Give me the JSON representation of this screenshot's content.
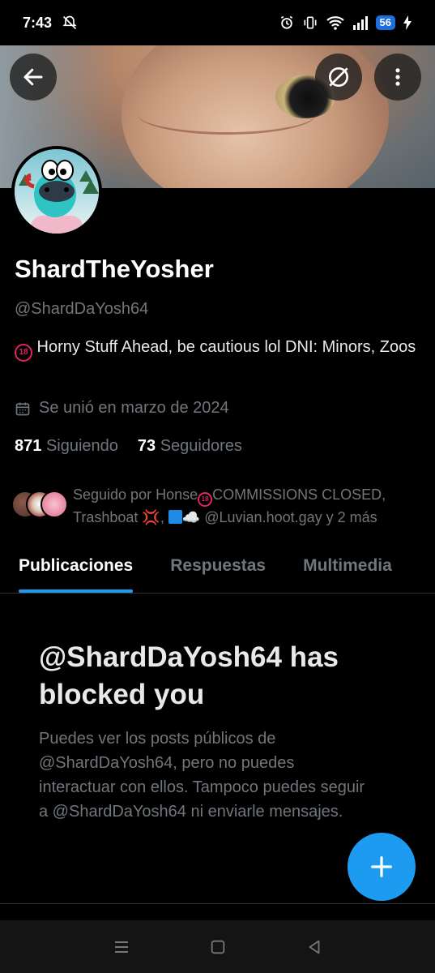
{
  "status_bar": {
    "time": "7:43",
    "battery_level": "56"
  },
  "header": {
    "back_icon": "arrow-left-icon",
    "translate_icon": "grok-circle-icon",
    "more_icon": "more-vertical-icon"
  },
  "profile": {
    "display_name": "ShardTheYosher",
    "handle": "@ShardDaYosh64",
    "bio_badge": "18",
    "bio_text": " Horny Stuff Ahead, be cautious lol  DNI: Minors, Zoos",
    "joined_text": "Se unió en marzo de 2024",
    "following_count": "871",
    "following_label": "Siguiendo",
    "followers_count": "73",
    "followers_label": "Seguidores",
    "followed_by_prefix": "Seguido por Honse",
    "followed_by_badge": "18",
    "followed_by_part1": "COMMISSIONS CLOSED, Trashboat ",
    "followed_by_emoji": "💢",
    "followed_by_part2": ", ",
    "followed_by_cloud": "☁️",
    "followed_by_part3": " @Luvian.hoot.gay y 2 más"
  },
  "tabs": [
    {
      "label": "Publicaciones",
      "active": true
    },
    {
      "label": "Respuestas",
      "active": false
    },
    {
      "label": "Multimedia",
      "active": false
    }
  ],
  "blocked": {
    "title": "@ShardDaYosh64 has blocked you",
    "message": "Puedes ver los posts públicos de @ShardDaYosh64, pero no puedes interactuar con ellos. Tampoco puedes seguir a @ShardDaYosh64 ni enviarle mensajes."
  },
  "fab": {
    "icon": "plus-icon"
  },
  "colors": {
    "accent": "#1d9bf0",
    "background": "#000000",
    "secondary_text": "#71767b"
  }
}
